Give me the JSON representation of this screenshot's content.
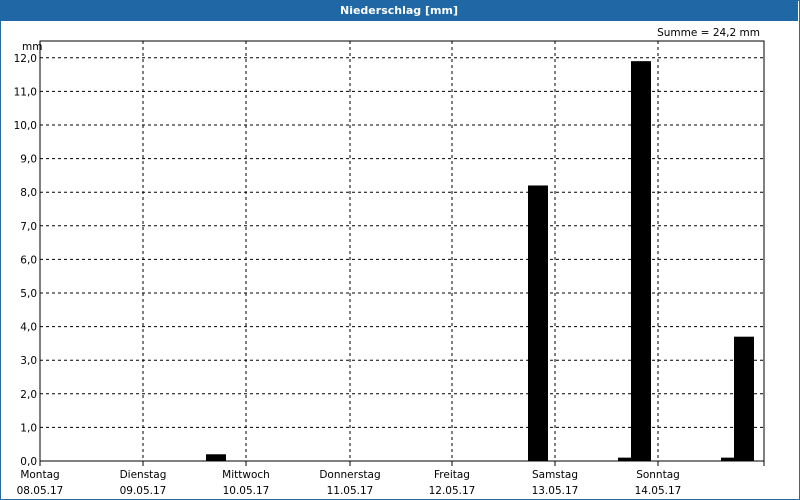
{
  "window": {
    "title": "Niederschlag [mm]"
  },
  "chart_data": {
    "type": "bar",
    "title": "Niederschlag [mm]",
    "ylabel": "mm",
    "ylim": [
      0,
      12
    ],
    "yticks": [
      "0,0",
      "1,0",
      "2,0",
      "3,0",
      "4,0",
      "5,0",
      "6,0",
      "7,0",
      "8,0",
      "9,0",
      "10,0",
      "11,0",
      "12,0"
    ],
    "annotation": "Summe = 24,2 mm",
    "grid": true,
    "days": [
      {
        "weekday": "Montag",
        "date": "08.05.17"
      },
      {
        "weekday": "Dienstag",
        "date": "09.05.17"
      },
      {
        "weekday": "Mittwoch",
        "date": "10.05.17"
      },
      {
        "weekday": "Donnerstag",
        "date": "11.05.17"
      },
      {
        "weekday": "Freitag",
        "date": "12.05.17"
      },
      {
        "weekday": "Samstag",
        "date": "13.05.17"
      },
      {
        "weekday": "Sonntag",
        "date": "14.05.17"
      }
    ],
    "bars": [
      {
        "day": 1,
        "slot": 0,
        "value": 0.2
      },
      {
        "day": 4,
        "slot": 1,
        "value": 8.2
      },
      {
        "day": 5,
        "slot": 0,
        "value": 0.1
      },
      {
        "day": 5,
        "slot": 1,
        "value": 11.9
      },
      {
        "day": 6,
        "slot": 0,
        "value": 0.1
      },
      {
        "day": 6,
        "slot": 1,
        "value": 3.7
      }
    ],
    "bar_color": "#000000"
  }
}
